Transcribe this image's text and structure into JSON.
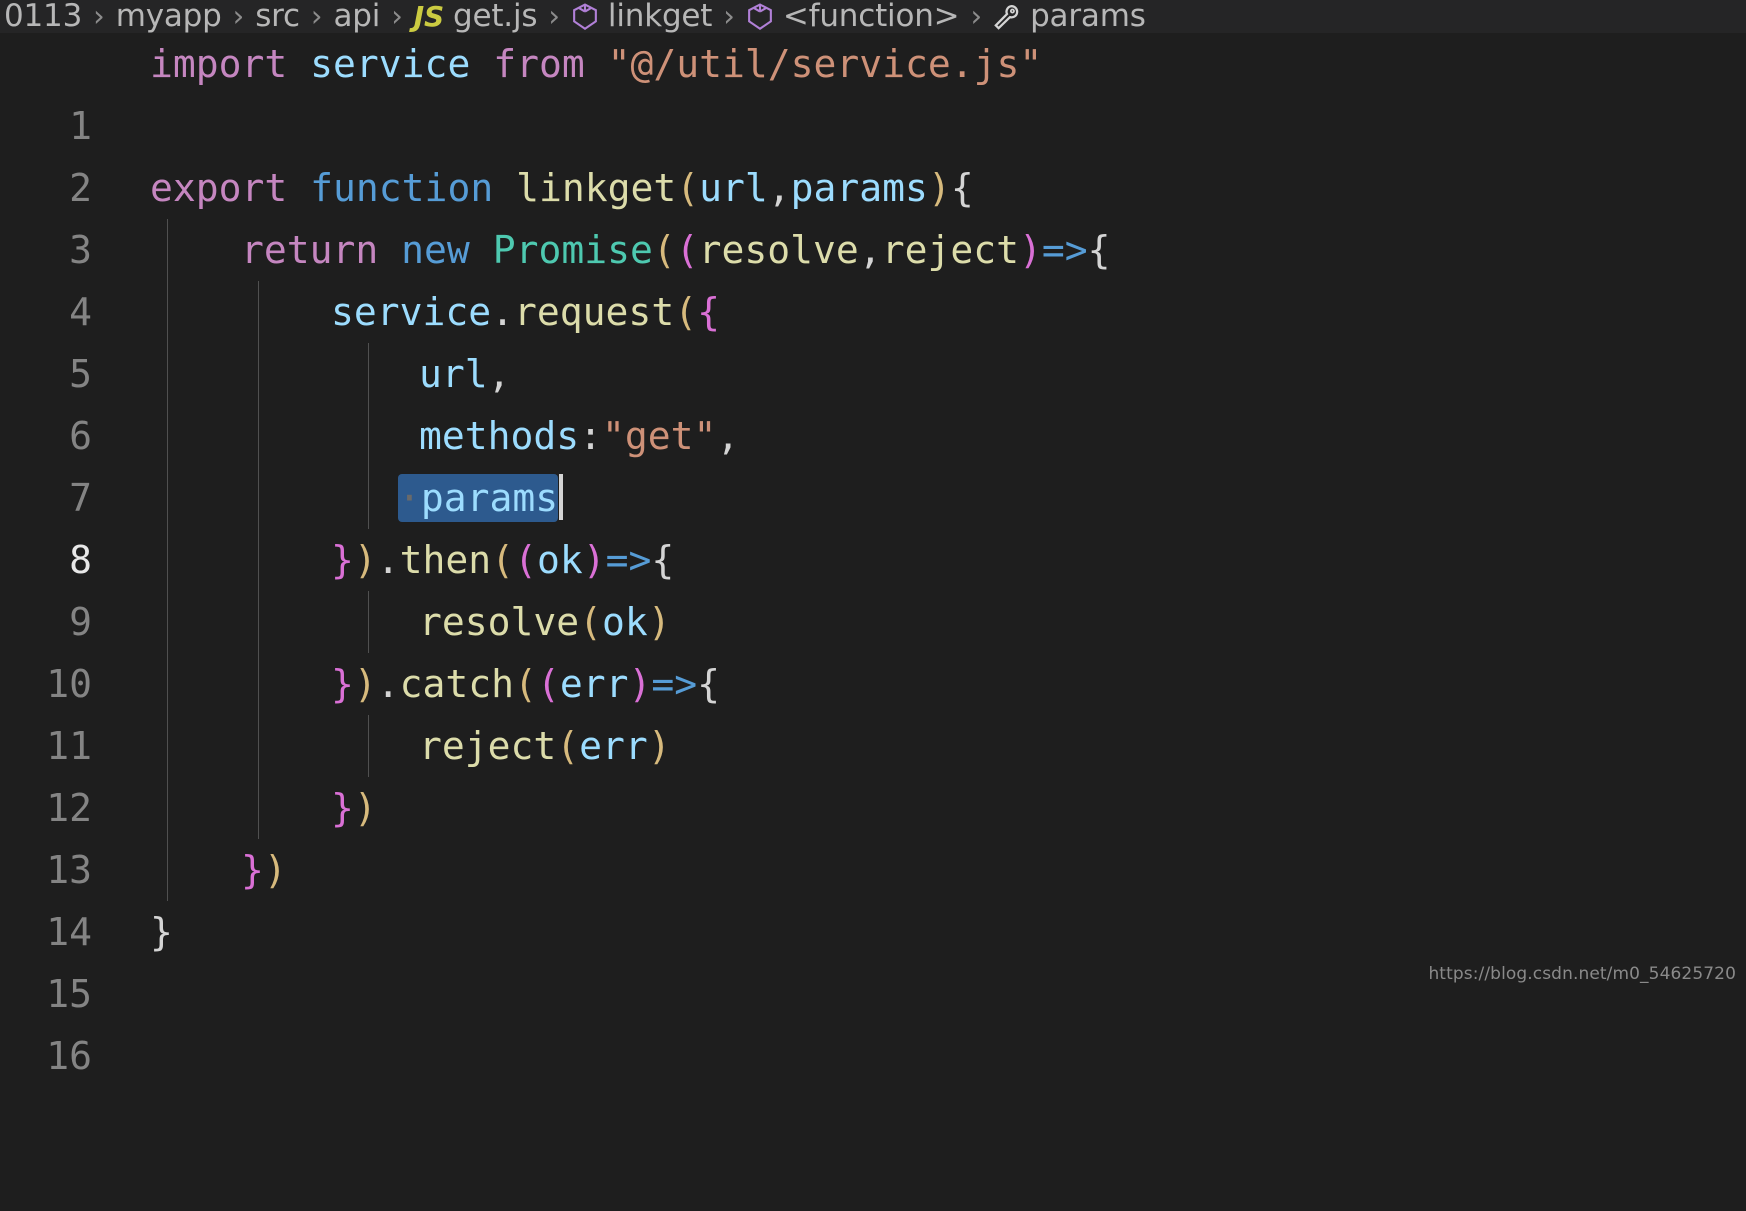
{
  "breadcrumb": {
    "items": [
      {
        "label": "0113",
        "icon": "none"
      },
      {
        "label": "myapp",
        "icon": "none"
      },
      {
        "label": "src",
        "icon": "none"
      },
      {
        "label": "api",
        "icon": "none"
      },
      {
        "label": "get.js",
        "icon": "js-file-icon"
      },
      {
        "label": "linkget",
        "icon": "symbol-method-icon"
      },
      {
        "label": "<function>",
        "icon": "symbol-method-icon"
      },
      {
        "label": "params",
        "icon": "symbol-property-icon"
      }
    ],
    "separator": "›"
  },
  "editor": {
    "language": "javascript",
    "active_line": 8,
    "cursor_line": 8,
    "selection_text": "params",
    "line_numbers": [
      "1",
      "2",
      "3",
      "4",
      "5",
      "6",
      "7",
      "8",
      "9",
      "10",
      "11",
      "12",
      "13",
      "14",
      "15",
      "16"
    ],
    "lines": [
      {
        "num": "1",
        "text": "import service from \"@/util/service.js\""
      },
      {
        "num": "2",
        "text": ""
      },
      {
        "num": "3",
        "text": "export function linkget(url,params){"
      },
      {
        "num": "4",
        "text": "    return new Promise((resolve,reject)=>{"
      },
      {
        "num": "5",
        "text": "        service.request({"
      },
      {
        "num": "6",
        "text": "            url,"
      },
      {
        "num": "7",
        "text": "            methods:\"get\","
      },
      {
        "num": "8",
        "text": "            params"
      },
      {
        "num": "9",
        "text": "        }).then((ok)=>{"
      },
      {
        "num": "10",
        "text": "            resolve(ok)"
      },
      {
        "num": "11",
        "text": "        }).catch((err)=>{"
      },
      {
        "num": "12",
        "text": "            reject(err)"
      },
      {
        "num": "13",
        "text": "        })"
      },
      {
        "num": "14",
        "text": "    })"
      },
      {
        "num": "15",
        "text": "}"
      },
      {
        "num": "16",
        "text": ""
      }
    ],
    "tokens": {
      "l1": {
        "t1": "import",
        "t2": " ",
        "t3": "service",
        "t4": " ",
        "t5": "from",
        "t6": " ",
        "t7": "\"@/util/service.js\""
      },
      "l3": {
        "t1": "export",
        "t2": " ",
        "t3": "function",
        "t4": " ",
        "t5": "linkget",
        "t6": "(",
        "t7": "url",
        "t8": ",",
        "t9": "params",
        "t10": ")",
        "t11": "{"
      },
      "l4": {
        "t1": "return",
        "t2": " ",
        "t3": "new",
        "t4": " ",
        "t5": "Promise",
        "t6": "(",
        "t7": "(",
        "t8": "resolve",
        "t9": ",",
        "t10": "reject",
        "t11": ")",
        "t12": "=>",
        "t13": "{"
      },
      "l5": {
        "t1": "service",
        "t2": ".",
        "t3": "request",
        "t4": "(",
        "t5": "{"
      },
      "l6": {
        "t1": "url",
        "t2": ","
      },
      "l7": {
        "t1": "methods",
        "t2": ":",
        "t3": "\"get\"",
        "t4": ","
      },
      "l8": {
        "t1": "params"
      },
      "l9": {
        "t1": "}",
        "t2": ")",
        "t3": ".",
        "t4": "then",
        "t5": "(",
        "t6": "(",
        "t7": "ok",
        "t8": ")",
        "t9": "=>",
        "t10": "{"
      },
      "l10": {
        "t1": "resolve",
        "t2": "(",
        "t3": "ok",
        "t4": ")"
      },
      "l11": {
        "t1": "}",
        "t2": ")",
        "t3": ".",
        "t4": "catch",
        "t5": "(",
        "t6": "(",
        "t7": "err",
        "t8": ")",
        "t9": "=>",
        "t10": "{"
      },
      "l12": {
        "t1": "reject",
        "t2": "(",
        "t3": "err",
        "t4": ")"
      },
      "l13": {
        "t1": "}",
        "t2": ")"
      },
      "l14": {
        "t1": "}",
        "t2": ")"
      },
      "l15": {
        "t1": "}"
      }
    }
  },
  "watermark": {
    "url": "https://blog.csdn.net/m0_54625720"
  },
  "colors": {
    "background": "#1e1e1e",
    "breadcrumb_background": "#252526",
    "line_number": "#848484",
    "active_line_number": "#e8e8e8",
    "selection": "#2d5a8e",
    "cursor": "#d4d4d4",
    "keyword": "#c586c0",
    "keyword_blue": "#569cd6",
    "variable": "#9cdcfe",
    "function": "#dcdcaa",
    "class": "#4ec9b0",
    "string": "#ce9178",
    "punctuation": "#d4d4d4",
    "js_icon": "#cbcb41",
    "symbol_icon": "#b180d7"
  }
}
